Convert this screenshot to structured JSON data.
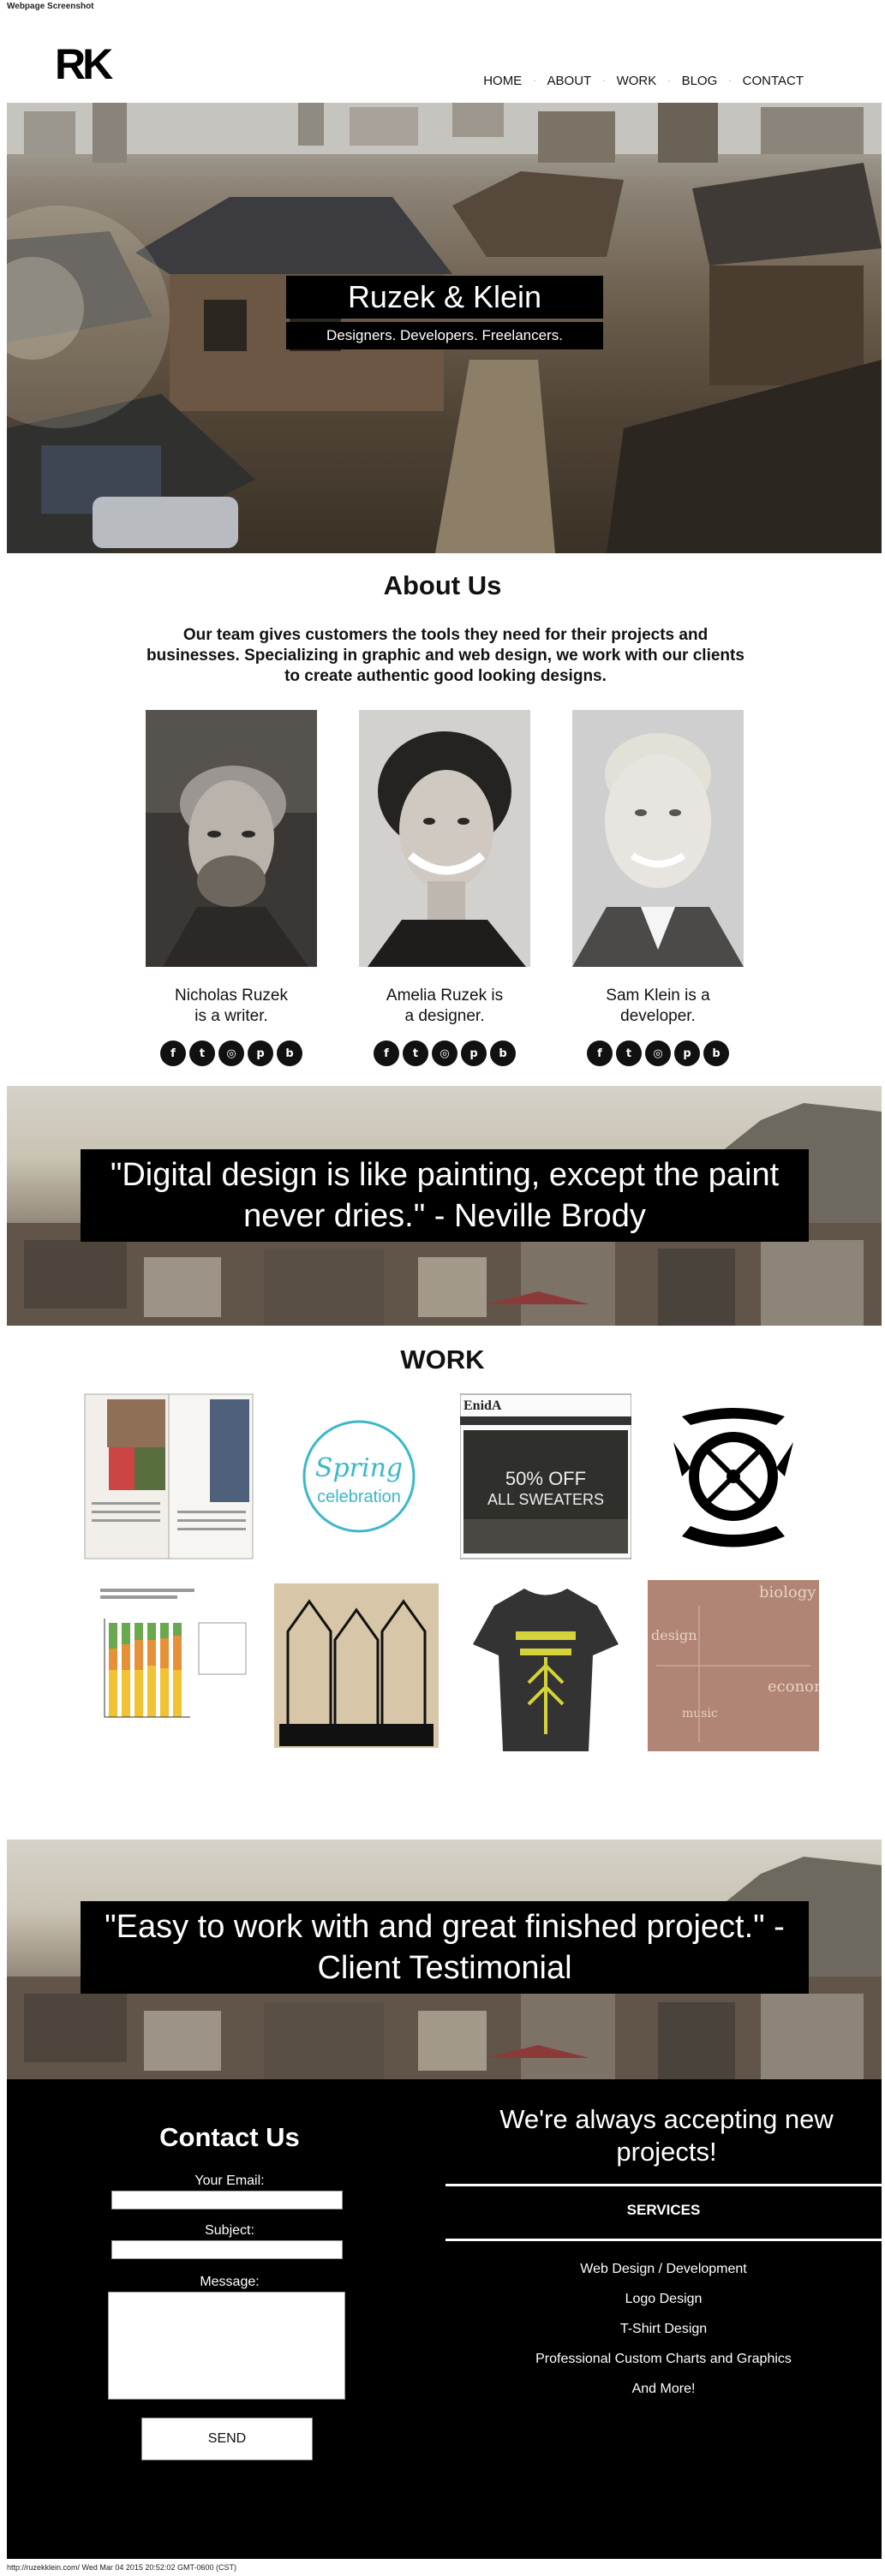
{
  "screenshot_label": "Webpage Screenshot",
  "footer_label": "http://ruzekklein.com/ Wed Mar 04 2015 20:52:02 GMT-0600 (CST)",
  "brand": {
    "logo": "RK"
  },
  "nav": {
    "items": [
      "HOME",
      "ABOUT",
      "WORK",
      "BLOG",
      "CONTACT"
    ],
    "separator": "·"
  },
  "hero": {
    "title": "Ruzek & Klein",
    "subtitle": "Designers. Developers. Freelancers."
  },
  "about": {
    "title": "About Us",
    "text": "Our team gives customers the tools they need for their projects and businesses. Specializing in graphic and web design, we work with our clients to create authentic good looking designs.",
    "members": [
      {
        "caption": "Nicholas Ruzek is a writer."
      },
      {
        "caption": "Amelia Ruzek is a designer."
      },
      {
        "caption": "Sam Klein is a developer."
      }
    ],
    "social_icons": [
      "facebook-icon",
      "twitter-icon",
      "dribbble-icon",
      "pinterest-icon",
      "blogger-icon"
    ],
    "social_glyphs": [
      "f",
      "t",
      "◎",
      "p",
      "b"
    ]
  },
  "quote1": {
    "text": "\"Digital design is like painting, except the paint never dries.\" - Neville Brody"
  },
  "work": {
    "title": "WORK",
    "items": [
      {
        "name": "magazine-spread"
      },
      {
        "name": "spring-celebration-logo",
        "line1": "Spring",
        "line2": "celebration"
      },
      {
        "name": "enida-website",
        "brand": "EnidA",
        "promo1": "50% OFF",
        "promo2": "ALL SWEATERS"
      },
      {
        "name": "emblem-logo"
      },
      {
        "name": "infographic-chart"
      },
      {
        "name": "buildings-illustration"
      },
      {
        "name": "tshirt-design"
      },
      {
        "name": "typography-collage",
        "word1": "biology",
        "word2": "design",
        "word3": "econom",
        "word4": "music"
      }
    ]
  },
  "quote2": {
    "text": "\"Easy to work with and great finished project.\" - Client Testimonial"
  },
  "contact": {
    "title": "Contact Us",
    "email_label": "Your Email:",
    "subject_label": "Subject:",
    "message_label": "Message:",
    "send_label": "SEND",
    "always": "We're always accepting new projects!",
    "services_title": "SERVICES",
    "services": [
      "Web Design / Development",
      "Logo Design",
      "T-Shirt Design",
      "Professional Custom Charts and Graphics",
      "And More!"
    ]
  }
}
